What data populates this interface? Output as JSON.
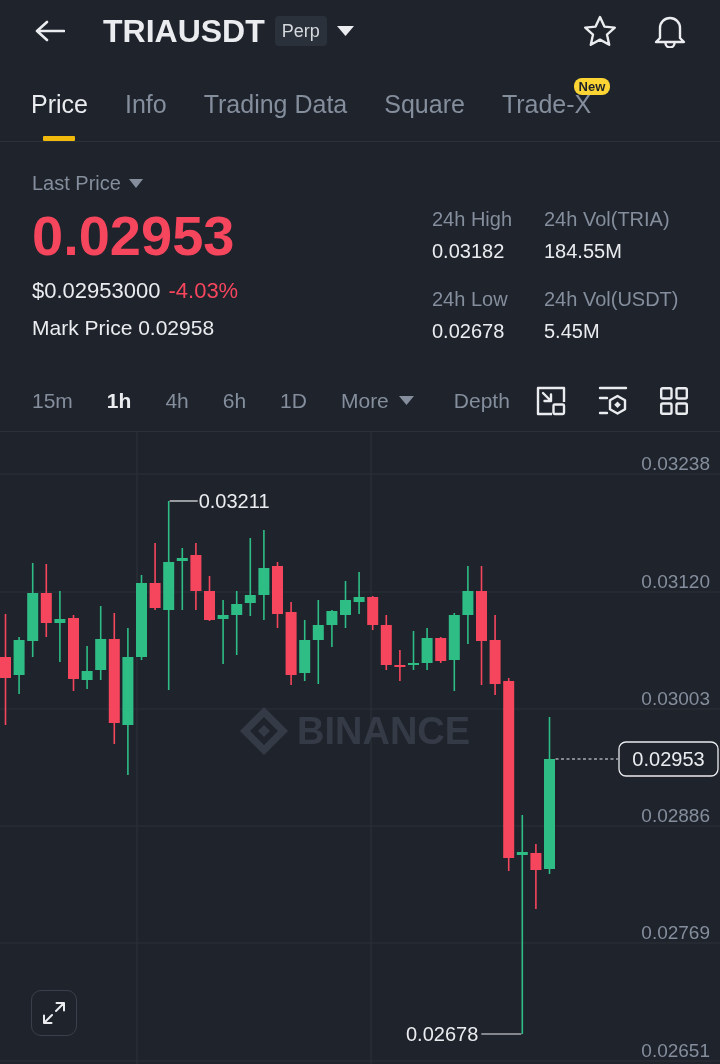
{
  "header": {
    "symbol": "TRIAUSDT",
    "contract_type": "Perp"
  },
  "tabs": [
    {
      "label": "Price",
      "selected": true
    },
    {
      "label": "Info",
      "selected": false
    },
    {
      "label": "Trading Data",
      "selected": false
    },
    {
      "label": "Square",
      "selected": false
    },
    {
      "label": "Trade-X",
      "selected": false,
      "badge": "New"
    }
  ],
  "price_panel": {
    "price_type": "Last Price",
    "last_price": "0.02953",
    "usd_price": "$0.02953000",
    "change": "-4.03%",
    "mark_price": "Mark Price 0.02958",
    "stats": [
      {
        "label": "24h High",
        "value": "0.03182"
      },
      {
        "label": "24h Vol(TRIA)",
        "value": "184.55M"
      },
      {
        "label": "24h Low",
        "value": "0.02678"
      },
      {
        "label": "24h Vol(USDT)",
        "value": "5.45M"
      }
    ]
  },
  "chart_toolbar": {
    "intervals": [
      {
        "label": "15m",
        "selected": false
      },
      {
        "label": "1h",
        "selected": true
      },
      {
        "label": "4h",
        "selected": false
      },
      {
        "label": "6h",
        "selected": false
      },
      {
        "label": "1D",
        "selected": false
      }
    ],
    "more": "More",
    "depth": {
      "label": "Depth",
      "selected": false
    }
  },
  "chart": {
    "watermark": "BINANCE",
    "high_label": "0.03211",
    "low_label": "0.02678",
    "current_price": "0.02953",
    "chart_data": {
      "type": "candlestick",
      "grid": true,
      "ohlc": [
        [
          0.03055,
          0.03098,
          0.02987,
          0.03034
        ],
        [
          0.03037,
          0.03075,
          0.03018,
          0.03072
        ],
        [
          0.03071,
          0.03149,
          0.03055,
          0.03119
        ],
        [
          0.03119,
          0.03148,
          0.03075,
          0.03089
        ],
        [
          0.03089,
          0.03121,
          0.0305,
          0.03093
        ],
        [
          0.03094,
          0.03097,
          0.03021,
          0.03033
        ],
        [
          0.03032,
          0.03066,
          0.03023,
          0.03041
        ],
        [
          0.03042,
          0.03106,
          0.03032,
          0.03073
        ],
        [
          0.03073,
          0.03099,
          0.02968,
          0.02989
        ],
        [
          0.02987,
          0.03084,
          0.02937,
          0.03055
        ],
        [
          0.03055,
          0.03137,
          0.03052,
          0.03129
        ],
        [
          0.03129,
          0.03169,
          0.03102,
          0.03104
        ],
        [
          0.03102,
          0.03211,
          0.03022,
          0.0315
        ],
        [
          0.03151,
          0.03164,
          0.03102,
          0.03154
        ],
        [
          0.03157,
          0.03169,
          0.03102,
          0.03121
        ],
        [
          0.03121,
          0.03136,
          0.03091,
          0.03092
        ],
        [
          0.03093,
          0.03112,
          0.03048,
          0.03097
        ],
        [
          0.03097,
          0.03121,
          0.03057,
          0.03108
        ],
        [
          0.03109,
          0.03174,
          0.03096,
          0.03117
        ],
        [
          0.03117,
          0.03182,
          0.03092,
          0.03144
        ],
        [
          0.03146,
          0.0315,
          0.03084,
          0.03098
        ],
        [
          0.031,
          0.0311,
          0.03027,
          0.03037
        ],
        [
          0.03039,
          0.03092,
          0.03031,
          0.03072
        ],
        [
          0.03072,
          0.03112,
          0.03028,
          0.03087
        ],
        [
          0.03087,
          0.03102,
          0.03065,
          0.03101
        ],
        [
          0.03097,
          0.03131,
          0.03084,
          0.03112
        ],
        [
          0.0311,
          0.0314,
          0.03098,
          0.03115
        ],
        [
          0.03115,
          0.03116,
          0.03082,
          0.03087
        ],
        [
          0.03087,
          0.03097,
          0.03042,
          0.03047
        ],
        [
          0.03047,
          0.03062,
          0.03031,
          0.03045
        ],
        [
          0.03047,
          0.03081,
          0.03042,
          0.03049
        ],
        [
          0.03049,
          0.03084,
          0.03042,
          0.03074
        ],
        [
          0.03074,
          0.03075,
          0.03049,
          0.03051
        ],
        [
          0.03052,
          0.03099,
          0.03021,
          0.03097
        ],
        [
          0.03097,
          0.03146,
          0.03068,
          0.03121
        ],
        [
          0.03121,
          0.03146,
          0.03027,
          0.03071
        ],
        [
          0.03072,
          0.03097,
          0.03017,
          0.03028
        ],
        [
          0.03031,
          0.03034,
          0.02841,
          0.02854
        ],
        [
          0.02857,
          0.02897,
          0.02678,
          0.0286
        ],
        [
          0.02859,
          0.02868,
          0.02803,
          0.02842
        ],
        [
          0.02843,
          0.02995,
          0.02838,
          0.02953
        ]
      ],
      "ylim": [
        0.02648,
        0.0328
      ],
      "yticks": [
        {
          "value": 0.03238,
          "label": "0.03238"
        },
        {
          "value": 0.0312,
          "label": "0.03120"
        },
        {
          "value": 0.03003,
          "label": "0.03003"
        },
        {
          "value": 0.02886,
          "label": "0.02886"
        },
        {
          "value": 0.02769,
          "label": "0.02769"
        },
        {
          "value": 0.02651,
          "label": "0.02651"
        }
      ]
    }
  }
}
